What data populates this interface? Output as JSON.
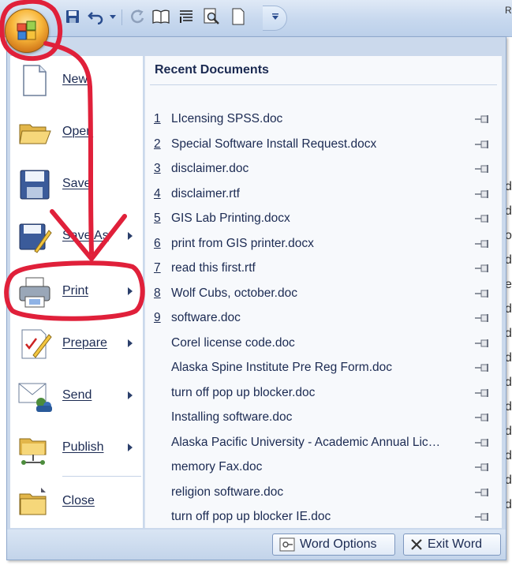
{
  "quick_access": {
    "icons": [
      "save-icon",
      "undo-icon",
      "undo-dropdown-icon",
      "redo-icon",
      "book-icon",
      "paragraph-icon",
      "print-preview-icon",
      "new-doc-icon",
      "customize-icon"
    ],
    "ribbon_fragment": "R"
  },
  "office_button": {
    "icon": "office-logo-icon"
  },
  "menu": {
    "commands": [
      {
        "label": "New",
        "icon": "new-document-icon",
        "submenu": false
      },
      {
        "label": "Open",
        "icon": "open-folder-icon",
        "submenu": false
      },
      {
        "label": "Save",
        "icon": "floppy-disk-icon",
        "submenu": false
      },
      {
        "label": "Save As",
        "icon": "save-as-icon",
        "submenu": true
      },
      {
        "label": "Print",
        "icon": "printer-icon",
        "submenu": true
      },
      {
        "label": "Prepare",
        "icon": "prepare-icon",
        "submenu": true
      },
      {
        "label": "Send",
        "icon": "send-icon",
        "submenu": true
      },
      {
        "label": "Publish",
        "icon": "publish-icon",
        "submenu": true
      },
      {
        "label": "Close",
        "icon": "close-folder-icon",
        "submenu": false
      }
    ],
    "recent": {
      "heading": "Recent Documents",
      "items": [
        {
          "num": "1",
          "name": "LIcensing SPSS.doc"
        },
        {
          "num": "2",
          "name": "Special Software Install Request.docx"
        },
        {
          "num": "3",
          "name": "disclaimer.doc"
        },
        {
          "num": "4",
          "name": "disclaimer.rtf"
        },
        {
          "num": "5",
          "name": "GIS Lab Printing.docx"
        },
        {
          "num": "6",
          "name": "print from GIS printer.docx"
        },
        {
          "num": "7",
          "name": "read this first.rtf"
        },
        {
          "num": "8",
          "name": "Wolf Cubs, october.doc"
        },
        {
          "num": "9",
          "name": "software.doc"
        },
        {
          "num": "",
          "name": "Corel license code.doc"
        },
        {
          "num": "",
          "name": "Alaska Spine Institute Pre Reg Form.doc"
        },
        {
          "num": "",
          "name": "turn off pop up blocker.doc"
        },
        {
          "num": "",
          "name": "Installing software.doc"
        },
        {
          "num": "",
          "name": "Alaska Pacific University - Academic Annual Lic…"
        },
        {
          "num": "",
          "name": "memory Fax.doc"
        },
        {
          "num": "",
          "name": "religion software.doc"
        },
        {
          "num": "",
          "name": "turn off pop up blocker IE.doc"
        }
      ]
    },
    "footer": {
      "word_options": "Word Options",
      "exit_word": "Exit Word"
    }
  },
  "background_doc": {
    "chars": [
      "d",
      "d",
      "o",
      "d",
      "e",
      "d",
      "d",
      "d",
      "d",
      "d",
      "d",
      "d",
      "d",
      "d"
    ]
  },
  "colors": {
    "annotation_red": "#e0203a",
    "menu_text": "#1b2a52",
    "menu_bg": "#cbd9ec"
  }
}
